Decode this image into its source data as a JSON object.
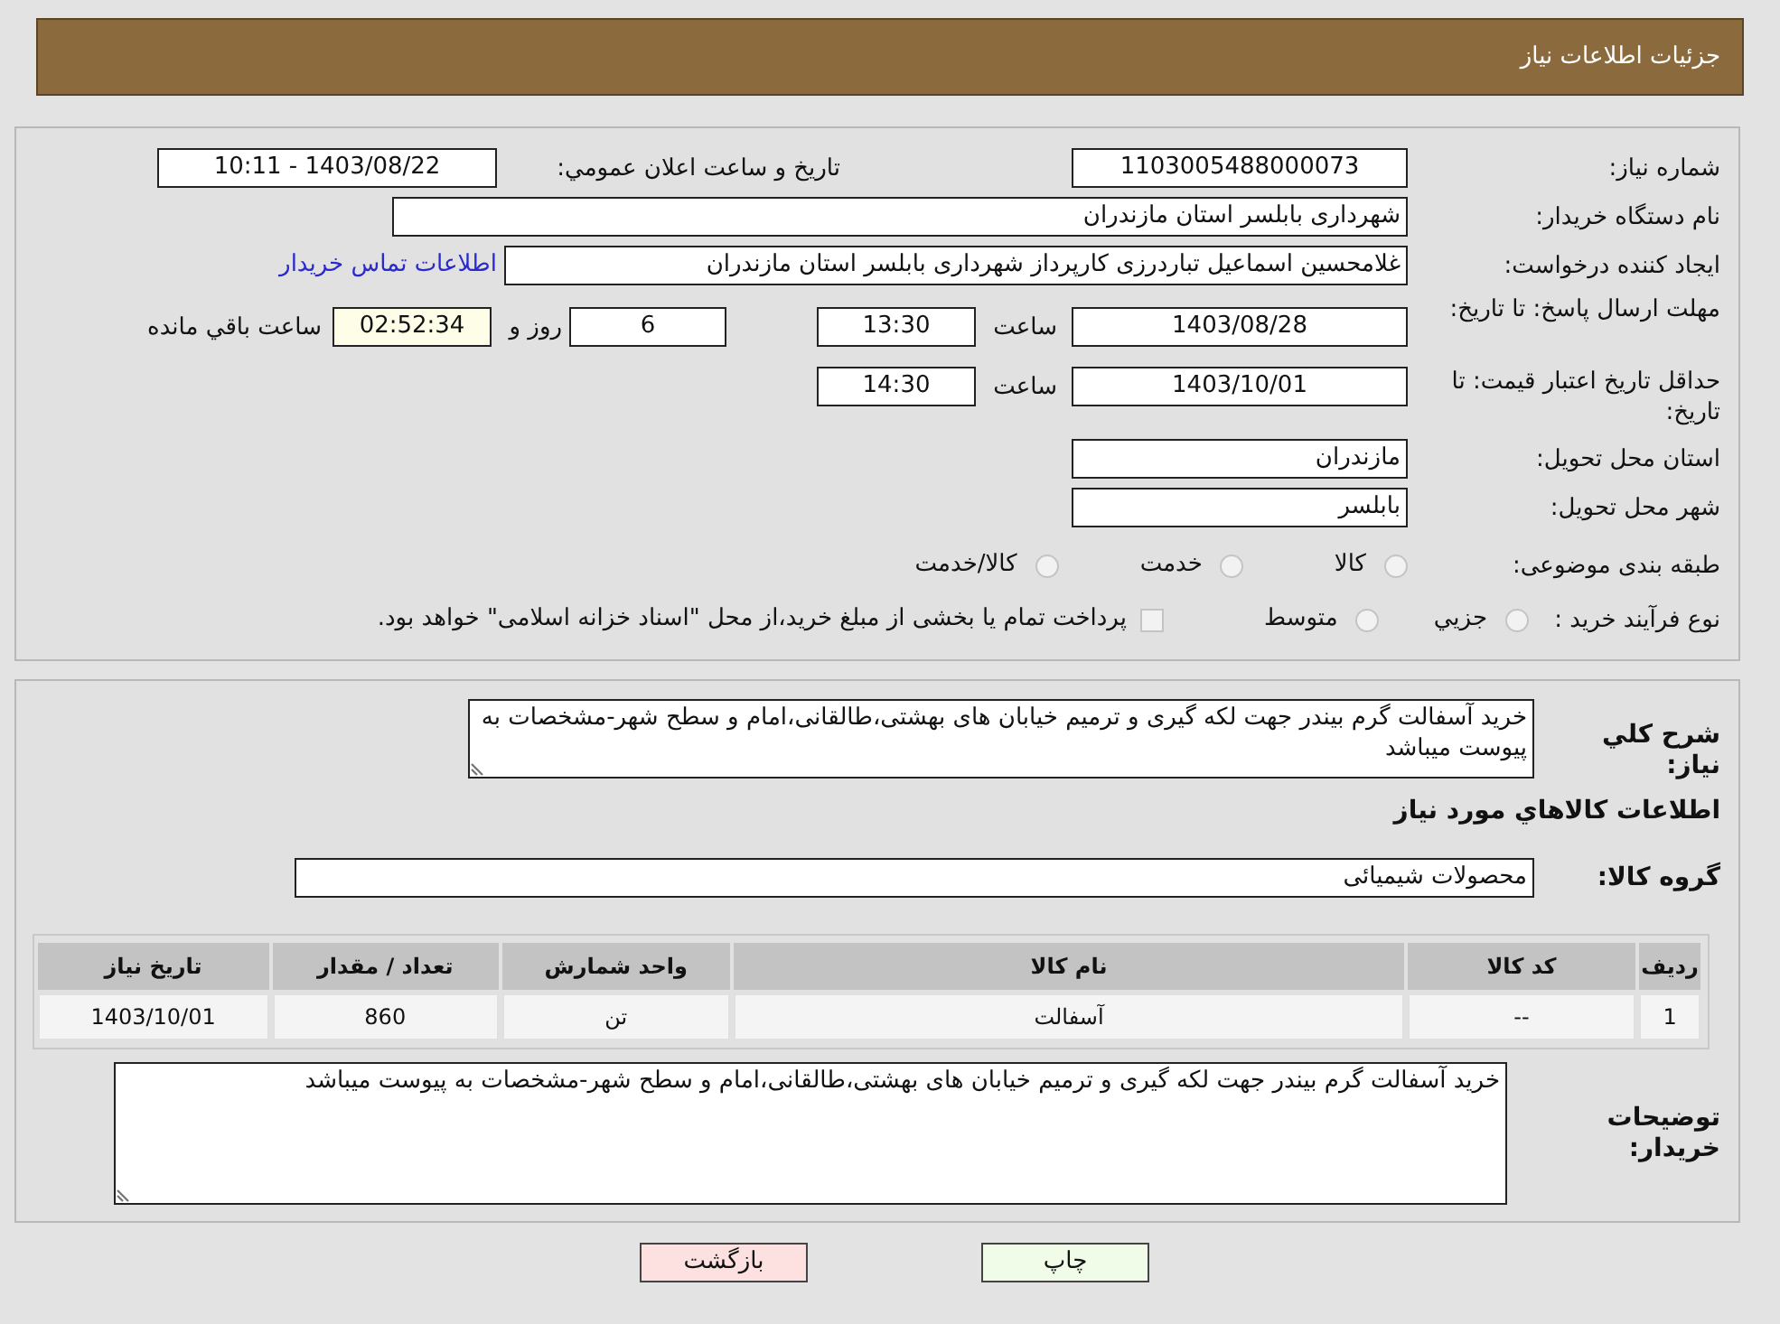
{
  "page_title": "جزئیات اطلاعات نیاز",
  "need_number": {
    "label": "شماره نیاز:",
    "value": "1103005488000073"
  },
  "announce": {
    "label": "تاريخ و ساعت اعلان عمومي:",
    "value": "1403/08/22 - 10:11"
  },
  "buyer": {
    "label": "نام دستگاه خریدار:",
    "value": "شهرداری بابلسر استان مازندران"
  },
  "requester": {
    "label": "ایجاد کننده درخواست:",
    "value": "غلامحسین اسماعیل تباردرزی کارپرداز شهرداری بابلسر استان مازندران",
    "link": "اطلاعات تماس خریدار"
  },
  "reply_deadline": {
    "label": "مهلت ارسال پاسخ: تا تاریخ:",
    "date": "1403/08/28",
    "time_label": "ساعت",
    "time": "13:30",
    "days": "6",
    "days_label": "روز و",
    "remaining": "02:52:34",
    "remaining_label": "ساعت باقي مانده"
  },
  "price_validity": {
    "label": "حداقل تاریخ اعتبار قیمت: تا تاریخ:",
    "date": "1403/10/01",
    "time_label": "ساعت",
    "time": "14:30"
  },
  "province": {
    "label": "استان محل تحویل:",
    "value": "مازندران"
  },
  "city": {
    "label": "شهر محل تحویل:",
    "value": "بابلسر"
  },
  "category": {
    "label": "طبقه بندی موضوعی:",
    "options": [
      {
        "label": "کالا",
        "selected": false
      },
      {
        "label": "خدمت",
        "selected": false
      },
      {
        "label": "کالا/خدمت",
        "selected": false
      }
    ]
  },
  "purchase_type": {
    "label": "نوع فرآیند خرید :",
    "options": [
      {
        "label": "جزيي",
        "selected": false
      },
      {
        "label": "متوسط",
        "selected": false
      }
    ],
    "payment_note": {
      "checked": false,
      "text": "پرداخت تمام یا بخشی از مبلغ خرید،از محل \"اسناد خزانه اسلامی\" خواهد بود."
    }
  },
  "description": {
    "label": "شرح کلي نياز:",
    "value": "خرید آسفالت گرم بیندر جهت لکه گیری و ترمیم خیابان های بهشتی،طالقانی،امام و سطح شهر-مشخصات به پیوست میباشد"
  },
  "goods_heading": "اطلاعات کالاهاي مورد نياز",
  "goods_group": {
    "label": "گروه کالا:",
    "value": "محصولات شیمیائی"
  },
  "table": {
    "columns": [
      "ردیف",
      "کد کالا",
      "نام کالا",
      "واحد شمارش",
      "تعداد / مقدار",
      "تاریخ نیاز"
    ],
    "rows": [
      [
        "1",
        "--",
        "آسفالت",
        "تن",
        "860",
        "1403/10/01"
      ]
    ]
  },
  "buyer_notes": {
    "label": "توضیحات خریدار:",
    "value": "خرید آسفالت گرم بیندر جهت لکه گیری و ترمیم خیابان های بهشتی،طالقانی،امام و سطح شهر-مشخصات به پیوست میباشد"
  },
  "buttons": [
    {
      "label": "چاپ",
      "kind": "print"
    },
    {
      "label": "بازگشت",
      "kind": "back"
    }
  ]
}
